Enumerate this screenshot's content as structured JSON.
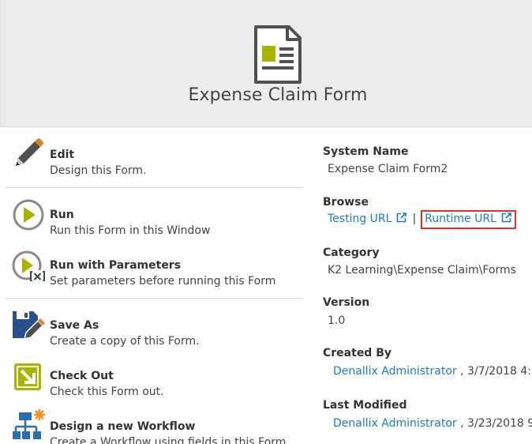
{
  "header": {
    "title": "Expense Claim Form",
    "icon": "form-document-icon"
  },
  "actions": [
    {
      "id": "edit",
      "title": "Edit",
      "description": "Design this Form.",
      "icon": "pencil-icon"
    },
    {
      "id": "run",
      "title": "Run",
      "description": "Run this Form in this Window",
      "icon": "play-icon"
    },
    {
      "id": "run-params",
      "title": "Run with Parameters",
      "description": "Set parameters before running this Form",
      "icon": "play-parameters-icon"
    },
    {
      "id": "save-as",
      "title": "Save As",
      "description": "Create a copy of this Form.",
      "icon": "save-as-icon"
    },
    {
      "id": "check-out",
      "title": "Check Out",
      "description": "Check this Form out.",
      "icon": "check-out-icon"
    },
    {
      "id": "design-workflow",
      "title": "Design a new Workflow",
      "description": "Create a Workflow using fields in this Form.",
      "icon": "workflow-icon"
    }
  ],
  "properties": {
    "system_name_label": "System Name",
    "system_name": "Expense Claim Form2",
    "browse_label": "Browse",
    "testing_url": "Testing URL",
    "separator": "|",
    "runtime_url": "Runtime URL",
    "category_label": "Category",
    "category": "K2 Learning\\Expense Claim\\Forms",
    "version_label": "Version",
    "version": "1.0",
    "created_by_label": "Created By",
    "created_by_user": "Denallix Administrator",
    "created_by_date": ", 3/7/2018 4:1",
    "last_modified_label": "Last Modified",
    "last_modified_user": "Denallix Administrator",
    "last_modified_date": ", 3/23/2018 9"
  },
  "colors": {
    "link": "#1a7ec4",
    "accent_olive": "#a8b400",
    "highlight_box": "#e0302b",
    "header_bg": "#ececec"
  }
}
